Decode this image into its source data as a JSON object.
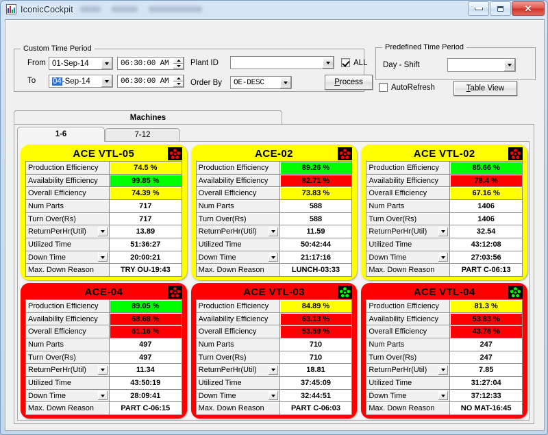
{
  "window": {
    "title": "IconicCockpit",
    "app_icon": "chart-icon",
    "minimize_label": "Minimize",
    "maximize_label": "Maximize",
    "close_label": "Close"
  },
  "custom_time_period": {
    "legend": "Custom Time Period",
    "from_label": "From",
    "from_date": "01-Sep-14",
    "from_time": "06:30:00 AM",
    "to_label": "To",
    "to_date_selected": "04",
    "to_date_rest": "-Sep-14",
    "to_time": "06:30:00 AM"
  },
  "plant": {
    "plant_id_label": "Plant ID",
    "plant_id_value": "",
    "all_label": "ALL",
    "all_checked": true,
    "order_by_label": "Order By",
    "order_by_value": "OE-DESC",
    "process_button": "Process"
  },
  "predefined_time_period": {
    "legend": "Predefined Time Period",
    "day_shift_label": "Day - Shift",
    "day_shift_value": "",
    "autorefresh_label": "AutoRefresh",
    "autorefresh_checked": false,
    "table_view_button": "Table View"
  },
  "tabs": {
    "main_tab": "Machines",
    "sub_tabs": [
      {
        "label": "1-6",
        "active": true
      },
      {
        "label": "7-12",
        "active": false
      }
    ]
  },
  "row_labels": {
    "production_efficiency": "Production Efficiency",
    "availability_efficiency": "Availability Efficiency",
    "overall_efficiency": "Overall Efficiency",
    "num_parts": "Num Parts",
    "turn_over": "Turn Over(Rs)",
    "return_per_hr": "ReturnPerHr(Util)",
    "utilized_time": "Utilized Time",
    "down_time": "Down Time",
    "max_down_reason": "Max. Down Reason"
  },
  "colors": {
    "yellow": "#ffff00",
    "green": "#00ff00",
    "red": "#fe0000",
    "white": "#ffffff"
  },
  "machines": [
    {
      "name": "ACE VTL-05",
      "panel_color": "yellow",
      "icon": "fan-status-icon",
      "icon_color": "#fe0000",
      "production_efficiency": "74.5 %",
      "production_efficiency_color": "yellow",
      "availability_efficiency": "99.85 %",
      "availability_efficiency_color": "green",
      "overall_efficiency": "74.39 %",
      "overall_efficiency_color": "yellow",
      "num_parts": "717",
      "turn_over": "717",
      "return_per_hr": "13.89",
      "utilized_time": "51:36:27",
      "down_time": "20:00:21",
      "max_down_reason": "TRY OU-19:43"
    },
    {
      "name": "ACE-02",
      "panel_color": "yellow",
      "icon": "fan-status-icon",
      "icon_color": "#fe0000",
      "production_efficiency": "89.26 %",
      "production_efficiency_color": "green",
      "availability_efficiency": "82.71 %",
      "availability_efficiency_color": "red",
      "overall_efficiency": "73.83 %",
      "overall_efficiency_color": "yellow",
      "num_parts": "588",
      "turn_over": "588",
      "return_per_hr": "11.59",
      "utilized_time": "50:42:44",
      "down_time": "21:17:16",
      "max_down_reason": "LUNCH-03:33"
    },
    {
      "name": "ACE VTL-02",
      "panel_color": "yellow",
      "icon": "fan-status-icon",
      "icon_color": "#fe0000",
      "production_efficiency": "85.66 %",
      "production_efficiency_color": "green",
      "availability_efficiency": "78.4 %",
      "availability_efficiency_color": "red",
      "overall_efficiency": "67.16 %",
      "overall_efficiency_color": "yellow",
      "num_parts": "1406",
      "turn_over": "1406",
      "return_per_hr": "32.54",
      "utilized_time": "43:12:08",
      "down_time": "27:03:56",
      "max_down_reason": "PART C-06:13"
    },
    {
      "name": "ACE-04",
      "panel_color": "red",
      "icon": "fan-status-icon",
      "icon_color": "#fe0000",
      "production_efficiency": "89.05 %",
      "production_efficiency_color": "green",
      "availability_efficiency": "68.68 %",
      "availability_efficiency_color": "red",
      "overall_efficiency": "61.16 %",
      "overall_efficiency_color": "red",
      "num_parts": "497",
      "turn_over": "497",
      "return_per_hr": "11.34",
      "utilized_time": "43:50:19",
      "down_time": "28:09:41",
      "max_down_reason": "PART C-06:15"
    },
    {
      "name": "ACE VTL-03",
      "panel_color": "red",
      "icon": "fan-status-icon",
      "icon_color": "#00ff00",
      "production_efficiency": "84.89 %",
      "production_efficiency_color": "yellow",
      "availability_efficiency": "63.13 %",
      "availability_efficiency_color": "red",
      "overall_efficiency": "53.59 %",
      "overall_efficiency_color": "red",
      "num_parts": "710",
      "turn_over": "710",
      "return_per_hr": "18.81",
      "utilized_time": "37:45:09",
      "down_time": "32:44:51",
      "max_down_reason": "PART C-06:03"
    },
    {
      "name": "ACE VTL-04",
      "panel_color": "red",
      "icon": "fan-status-icon",
      "icon_color": "#00ff00",
      "production_efficiency": "81.3 %",
      "production_efficiency_color": "yellow",
      "availability_efficiency": "53.83 %",
      "availability_efficiency_color": "red",
      "overall_efficiency": "43.76 %",
      "overall_efficiency_color": "red",
      "num_parts": "247",
      "turn_over": "247",
      "return_per_hr": "7.85",
      "utilized_time": "31:27:04",
      "down_time": "37:12:33",
      "max_down_reason": "NO MAT-16:45"
    }
  ]
}
